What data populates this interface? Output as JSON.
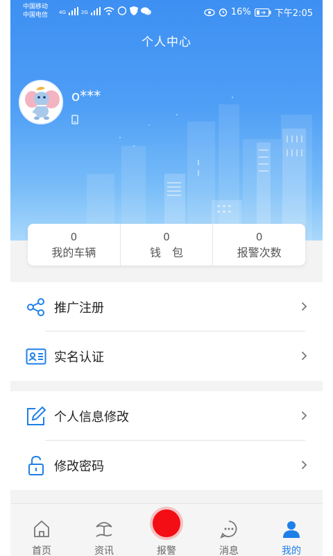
{
  "status_bar": {
    "carrier_1": "中国移动",
    "carrier_2": "中国电信",
    "network_1": "4G",
    "network_2": "2G",
    "battery": "16%",
    "time": "下午2:05"
  },
  "header": {
    "title": "个人中心",
    "username": "o***"
  },
  "stats": [
    {
      "value": "0",
      "label": "我的车辆"
    },
    {
      "value": "0",
      "label": "钱　包"
    },
    {
      "value": "0",
      "label": "报警次数"
    }
  ],
  "menu": {
    "group1": [
      {
        "label": "推广注册",
        "icon": "share-icon"
      },
      {
        "label": "实名认证",
        "icon": "id-card-icon"
      }
    ],
    "group2": [
      {
        "label": "个人信息修改",
        "icon": "edit-icon"
      },
      {
        "label": "修改密码",
        "icon": "lock-icon"
      }
    ]
  },
  "bottom_nav": [
    {
      "label": "首页",
      "icon": "home-icon"
    },
    {
      "label": "资讯",
      "icon": "beach-icon"
    },
    {
      "label": "报警",
      "icon": "alarm-button"
    },
    {
      "label": "消息",
      "icon": "chat-icon"
    },
    {
      "label": "我的",
      "icon": "user-icon",
      "active": true
    }
  ],
  "colors": {
    "accent": "#1e7fe8",
    "header_top": "#3d8ff2",
    "alarm": "#f20e14"
  }
}
